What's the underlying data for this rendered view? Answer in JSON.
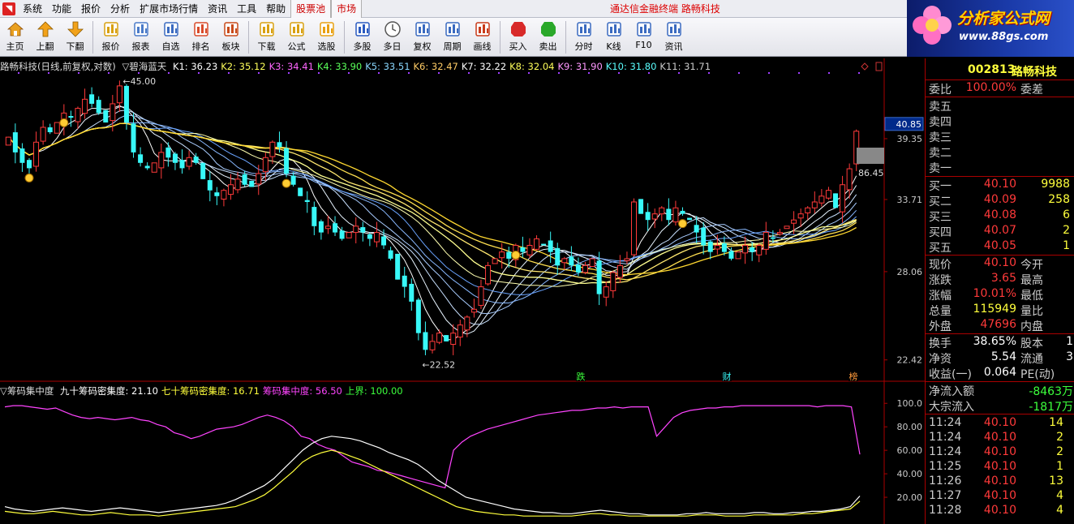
{
  "menubar": {
    "items": [
      "系统",
      "功能",
      "报价",
      "分析",
      "扩展市场行情",
      "资讯",
      "工具",
      "帮助"
    ],
    "tabs": [
      "股票池",
      "市场"
    ],
    "title": "通达信金融终端 路畅科技"
  },
  "logo": {
    "title": "分析家公式网",
    "url": "www.88gs.com"
  },
  "toolbar": {
    "buttons": [
      {
        "label": "主页",
        "icon": "home-icon"
      },
      {
        "label": "上翻",
        "icon": "arrow-up-icon"
      },
      {
        "label": "下翻",
        "icon": "arrow-down-icon"
      },
      {
        "label": "报价",
        "icon": "quote-icon"
      },
      {
        "label": "报表",
        "icon": "report-icon"
      },
      {
        "label": "自选",
        "icon": "watchlist-icon"
      },
      {
        "label": "排名",
        "icon": "rank-icon"
      },
      {
        "label": "板块",
        "icon": "sector-icon"
      },
      {
        "label": "下载",
        "icon": "download-icon"
      },
      {
        "label": "公式",
        "icon": "formula-icon"
      },
      {
        "label": "选股",
        "icon": "stock-pick-icon"
      },
      {
        "label": "多股",
        "icon": "multi-stock-icon"
      },
      {
        "label": "多日",
        "icon": "multi-day-icon"
      },
      {
        "label": "复权",
        "icon": "adjust-icon"
      },
      {
        "label": "周期",
        "icon": "period-icon"
      },
      {
        "label": "画线",
        "icon": "draw-line-icon"
      },
      {
        "label": "买入",
        "icon": "buy-icon"
      },
      {
        "label": "卖出",
        "icon": "sell-icon"
      },
      {
        "label": "分时",
        "icon": "intraday-icon"
      },
      {
        "label": "K线",
        "icon": "kline-icon"
      },
      {
        "label": "F10",
        "icon": "f10-icon"
      },
      {
        "label": "资讯",
        "icon": "news-icon"
      }
    ]
  },
  "main_chart": {
    "header_name": "路畅科技(日线,前复权,对数)",
    "indicator_name": "▽碧海蓝天",
    "k_values": [
      "K1: 36.23",
      "K2: 35.12",
      "K3: 34.41",
      "K4: 33.90",
      "K5: 33.51",
      "K6: 32.47",
      "K7: 32.22",
      "K8: 32.04",
      "K9: 31.90",
      "K10: 31.80",
      "K11: 31.71"
    ],
    "high_label": "45.00",
    "low_label": "22.52",
    "price_tag": "40.85",
    "right_marker": "86.45",
    "markers": [
      {
        "text": "跌",
        "color": "#3cff3c"
      },
      {
        "text": "财",
        "color": "#38f8f8"
      },
      {
        "text": "榜",
        "color": "#ff9a3a"
      }
    ],
    "y_axis_labels": [
      "39.35",
      "33.71",
      "28.06",
      "22.42"
    ]
  },
  "sub_chart": {
    "name": "▽筹码集中度",
    "items": [
      {
        "label": "九十筹码密集度: 21.10",
        "color": "#ffffff"
      },
      {
        "label": "七十筹码密集度: 16.71",
        "color": "#ffff3c"
      },
      {
        "label": "筹码集中度: 56.50",
        "color": "#ff44ff"
      },
      {
        "label": "上界: 100.00",
        "color": "#3cff3c"
      }
    ],
    "y_axis_labels": [
      "100.0",
      "80.00",
      "60.00",
      "40.00",
      "20.00"
    ]
  },
  "quote": {
    "code": "002813",
    "name": "路畅科技",
    "weibi_label": "委比",
    "weibi_value": "100.00%",
    "weicha_label": "委差",
    "asks": [
      "卖五",
      "卖四",
      "卖三",
      "卖二",
      "卖一"
    ],
    "bids": [
      {
        "label": "买一",
        "price": "40.10",
        "vol": "9988"
      },
      {
        "label": "买二",
        "price": "40.09",
        "vol": "258"
      },
      {
        "label": "买三",
        "price": "40.08",
        "vol": "6"
      },
      {
        "label": "买四",
        "price": "40.07",
        "vol": "2"
      },
      {
        "label": "买五",
        "price": "40.05",
        "vol": "1"
      }
    ],
    "stats": [
      {
        "l1": "现价",
        "v": "40.10",
        "c": "red",
        "l2": "今开"
      },
      {
        "l1": "涨跌",
        "v": "3.65",
        "c": "red",
        "l2": "最高"
      },
      {
        "l1": "涨幅",
        "v": "10.01%",
        "c": "red",
        "l2": "最低"
      },
      {
        "l1": "总量",
        "v": "115949",
        "c": "yellow",
        "l2": "量比"
      },
      {
        "l1": "外盘",
        "v": "47696",
        "c": "red",
        "l2": "内盘"
      }
    ],
    "stats2": [
      {
        "l1": "换手",
        "v": "38.65%",
        "l2": "股本",
        "v2": "1"
      },
      {
        "l1": "净资",
        "v": "5.54",
        "l2": "流通",
        "v2": "3"
      },
      {
        "l1": "收益(一)",
        "v": "0.064",
        "l2": "PE(动)",
        "v2": ""
      }
    ],
    "flows": [
      {
        "l": "净流入额",
        "v": "-8463万"
      },
      {
        "l": "大宗流入",
        "v": "-1817万"
      }
    ],
    "ticks": [
      {
        "t": "11:24",
        "p": "40.10",
        "v": "14"
      },
      {
        "t": "11:24",
        "p": "40.10",
        "v": "2"
      },
      {
        "t": "11:24",
        "p": "40.10",
        "v": "2"
      },
      {
        "t": "11:25",
        "p": "40.10",
        "v": "1"
      },
      {
        "t": "11:26",
        "p": "40.10",
        "v": "13"
      },
      {
        "t": "11:27",
        "p": "40.10",
        "v": "4"
      },
      {
        "t": "11:28",
        "p": "40.10",
        "v": "4"
      }
    ]
  },
  "chart_data": {
    "type": "candlestick",
    "price_axis": {
      "labels": [
        39.35,
        33.71,
        28.06,
        22.42
      ]
    },
    "closes": [
      39.5,
      38.0,
      37.0,
      36.5,
      39.0,
      40.5,
      40.0,
      41.0,
      42.0,
      41.5,
      42.5,
      43.5,
      43.0,
      42.0,
      41.0,
      43.0,
      45.0,
      41.0,
      38.0,
      37.0,
      36.5,
      37.0,
      38.0,
      37.5,
      37.0,
      36.5,
      37.5,
      37.0,
      35.5,
      34.5,
      34.0,
      34.5,
      35.0,
      35.5,
      35.0,
      34.8,
      36.0,
      37.5,
      39.0,
      38.5,
      36.0,
      35.0,
      34.0,
      33.5,
      31.5,
      31.0,
      31.5,
      31.0,
      30.5,
      31.0,
      31.5,
      31.0,
      30.5,
      31.0,
      30.0,
      29.0,
      27.5,
      27.0,
      26.0,
      24.0,
      23.0,
      23.5,
      24.0,
      23.5,
      24.0,
      24.5,
      25.0,
      25.5,
      27.0,
      28.5,
      29.0,
      29.5,
      29.0,
      30.0,
      29.5,
      30.0,
      30.5,
      30.0,
      29.5,
      28.5,
      29.0,
      28.5,
      28.0,
      28.5,
      29.0,
      26.5,
      27.0,
      28.0,
      28.5,
      29.0,
      33.5,
      32.5,
      32.0,
      32.5,
      33.0,
      32.0,
      33.0,
      32.5,
      32.0,
      31.0,
      30.0,
      29.5,
      30.0,
      29.5,
      29.0,
      29.5,
      30.0,
      29.5,
      30.0,
      31.0,
      30.5,
      31.0,
      31.5,
      32.0,
      32.5,
      33.0,
      33.5,
      34.0,
      34.5,
      33.0,
      35.0,
      36.45,
      40.1
    ],
    "chip_concentration": [
      97,
      98,
      98,
      97,
      96,
      95,
      96,
      93,
      90,
      88,
      87,
      88,
      87,
      86,
      87,
      88,
      86,
      85,
      82,
      80,
      75,
      73,
      70,
      72,
      75,
      78,
      79,
      80,
      82,
      85,
      88,
      90,
      88,
      85,
      80,
      72,
      70,
      65,
      62,
      60,
      55,
      50,
      48,
      46,
      43,
      42,
      40,
      38,
      36,
      34,
      32,
      30,
      28,
      60,
      67,
      72,
      75,
      78,
      80,
      82,
      84,
      86,
      88,
      90,
      91,
      92,
      93,
      94,
      94,
      95,
      96,
      96,
      97,
      96,
      97,
      97,
      97,
      72,
      80,
      88,
      92,
      94,
      95,
      96,
      96,
      97,
      97,
      98,
      98,
      98,
      98,
      98,
      98,
      98,
      98,
      98,
      97,
      98,
      98,
      98,
      97,
      56.5
    ],
    "ninety_density": [
      12,
      10,
      9,
      8,
      9,
      10,
      11,
      10,
      9,
      8,
      9,
      10,
      11,
      10,
      9,
      8,
      7,
      8,
      9,
      10,
      11,
      12,
      13,
      15,
      18,
      22,
      26,
      30,
      36,
      44,
      52,
      60,
      66,
      70,
      72,
      71,
      70,
      68,
      65,
      62,
      58,
      55,
      52,
      48,
      42,
      35,
      30,
      25,
      20,
      18,
      16,
      14,
      12,
      10,
      9,
      8,
      7,
      7,
      6,
      6,
      7,
      8,
      9,
      8,
      7,
      6,
      6,
      5,
      5,
      5,
      5,
      6,
      6,
      7,
      6,
      6,
      6,
      6,
      7,
      7,
      6,
      6,
      7,
      7,
      8,
      8,
      9,
      10,
      12,
      21.1
    ],
    "seventy_density": [
      8,
      7,
      6,
      6,
      7,
      8,
      7,
      6,
      5,
      5,
      6,
      7,
      6,
      5,
      5,
      5,
      4,
      5,
      6,
      7,
      8,
      9,
      10,
      11,
      12,
      15,
      18,
      22,
      28,
      35,
      42,
      50,
      55,
      58,
      60,
      58,
      55,
      52,
      48,
      44,
      40,
      36,
      32,
      28,
      24,
      20,
      16,
      12,
      10,
      8,
      7,
      6,
      5,
      5,
      4,
      4,
      4,
      4,
      4,
      4,
      5,
      6,
      6,
      5,
      5,
      4,
      4,
      4,
      4,
      4,
      4,
      4,
      5,
      5,
      5,
      4,
      4,
      4,
      5,
      5,
      5,
      5,
      5,
      6,
      6,
      7,
      8,
      9,
      10,
      16.71
    ]
  }
}
